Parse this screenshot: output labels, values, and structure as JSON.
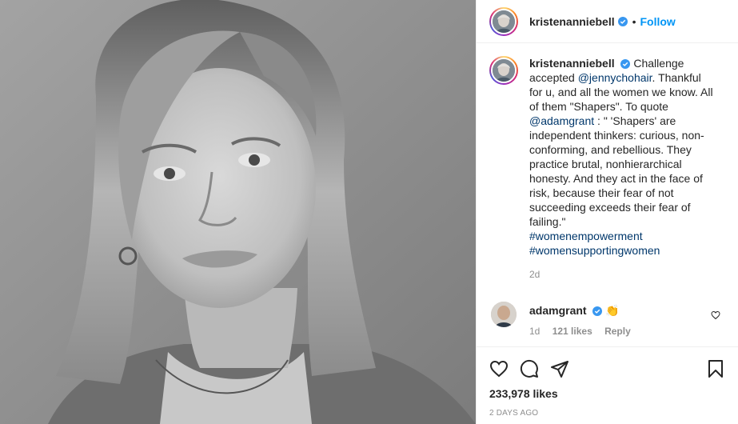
{
  "header": {
    "username": "kristenanniebell",
    "separator": "•",
    "follow_label": "Follow"
  },
  "caption": {
    "username": "kristenanniebell",
    "text_1": "Challenge accepted ",
    "mention_1": "@jennychohair",
    "text_2": ". Thankful for u, and all the women we know. All of them \"Shapers\". To quote ",
    "mention_2": "@adamgrant",
    "text_3": " : \" 'Shapers' are independent thinkers: curious, non-conforming, and rebellious. They practice brutal, nonhierarchical honesty. And they act in the face of risk, because their fear of not succeeding exceeds their fear of failing.\"",
    "hashtag_1": "#womenempowerment",
    "hashtag_2": "#womensupportingwomen",
    "time": "2d"
  },
  "comment": {
    "username": "adamgrant",
    "emoji": "👏",
    "time": "1d",
    "likes": "121 likes",
    "reply_label": "Reply"
  },
  "footer": {
    "likes": "233,978 likes",
    "date": "2 DAYS AGO"
  },
  "icons": {
    "verified": "verified-badge-icon",
    "like": "heart-icon",
    "comment": "comment-icon",
    "share": "share-icon",
    "save": "bookmark-icon"
  },
  "colors": {
    "link": "#00376b",
    "follow": "#0095f6",
    "verified": "#3897f0",
    "muted": "#8e8e8e"
  }
}
